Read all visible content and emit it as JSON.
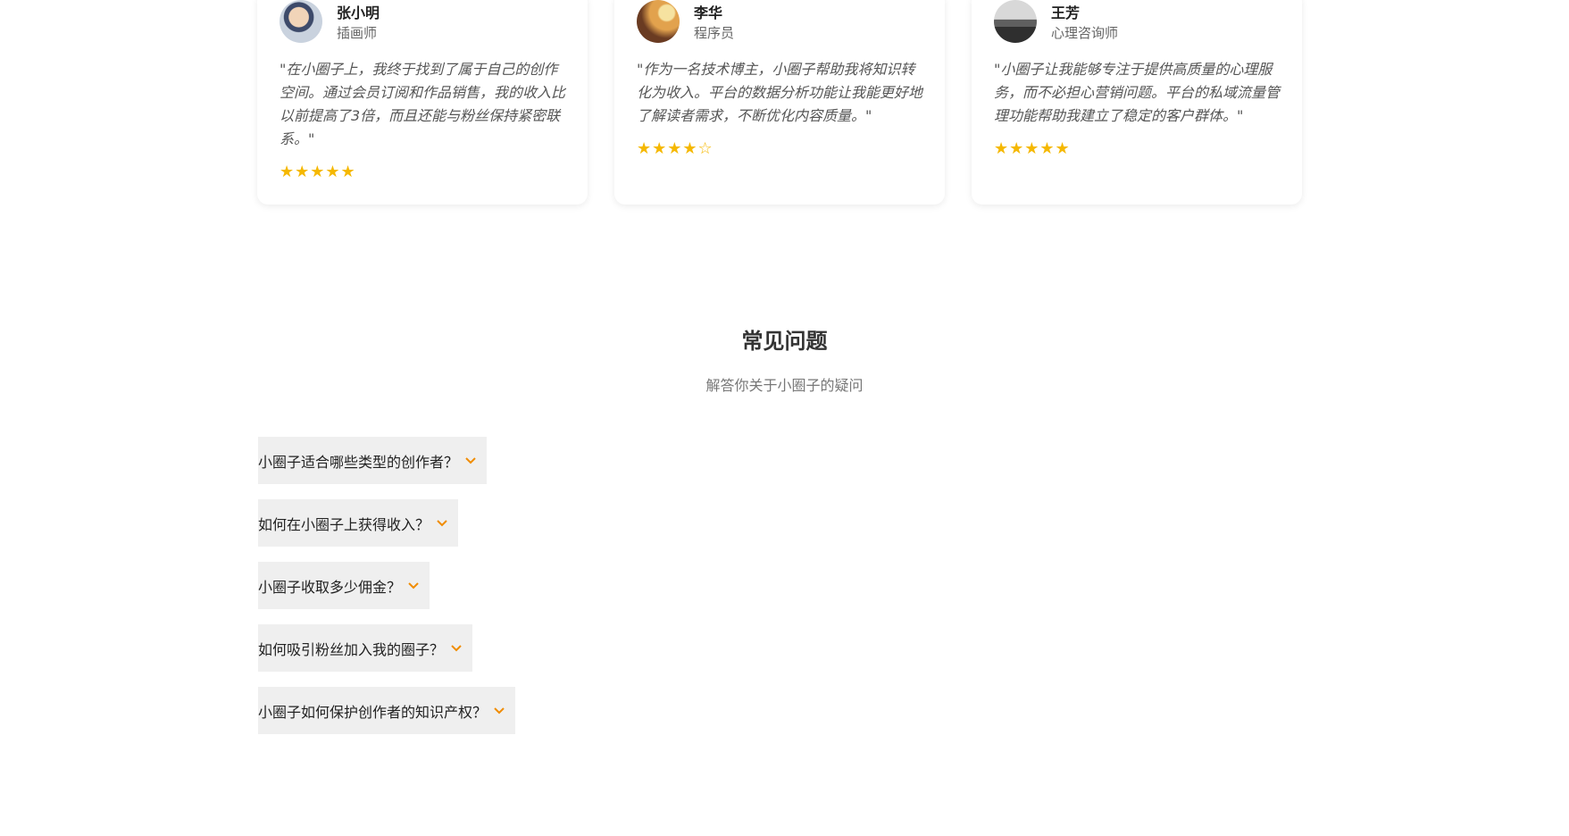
{
  "testimonials": [
    {
      "name": "张小明",
      "role": "插画师",
      "quote": "\"在小圈子上，我终于找到了属于自己的创作空间。通过会员订阅和作品销售，我的收入比以前提高了3倍，而且还能与粉丝保持紧密联系。\"",
      "rating": 5,
      "stars": "★★★★★"
    },
    {
      "name": "李华",
      "role": "程序员",
      "quote": "\"作为一名技术博主，小圈子帮助我将知识转化为收入。平台的数据分析功能让我能更好地了解读者需求，不断优化内容质量。\"",
      "rating": 4,
      "stars": "★★★★☆"
    },
    {
      "name": "王芳",
      "role": "心理咨询师",
      "quote": "\"小圈子让我能够专注于提供高质量的心理服务，而不必担心营销问题。平台的私域流量管理功能帮助我建立了稳定的客户群体。\"",
      "rating": 5,
      "stars": "★★★★★"
    }
  ],
  "faq": {
    "title": "常见问题",
    "subtitle": "解答你关于小圈子的疑问",
    "items": [
      {
        "question": "小圈子适合哪些类型的创作者？"
      },
      {
        "question": "如何在小圈子上获得收入？"
      },
      {
        "question": "小圈子收取多少佣金？"
      },
      {
        "question": "如何吸引粉丝加入我的圈子？"
      },
      {
        "question": "小圈子如何保护创作者的知识产权？"
      }
    ]
  },
  "colors": {
    "accent": "#f08c00",
    "star": "#f5b800",
    "faq_item_bg": "#efefef"
  },
  "icons": {
    "faq_toggle": "chevron-down-icon",
    "rating": "star-icon"
  }
}
